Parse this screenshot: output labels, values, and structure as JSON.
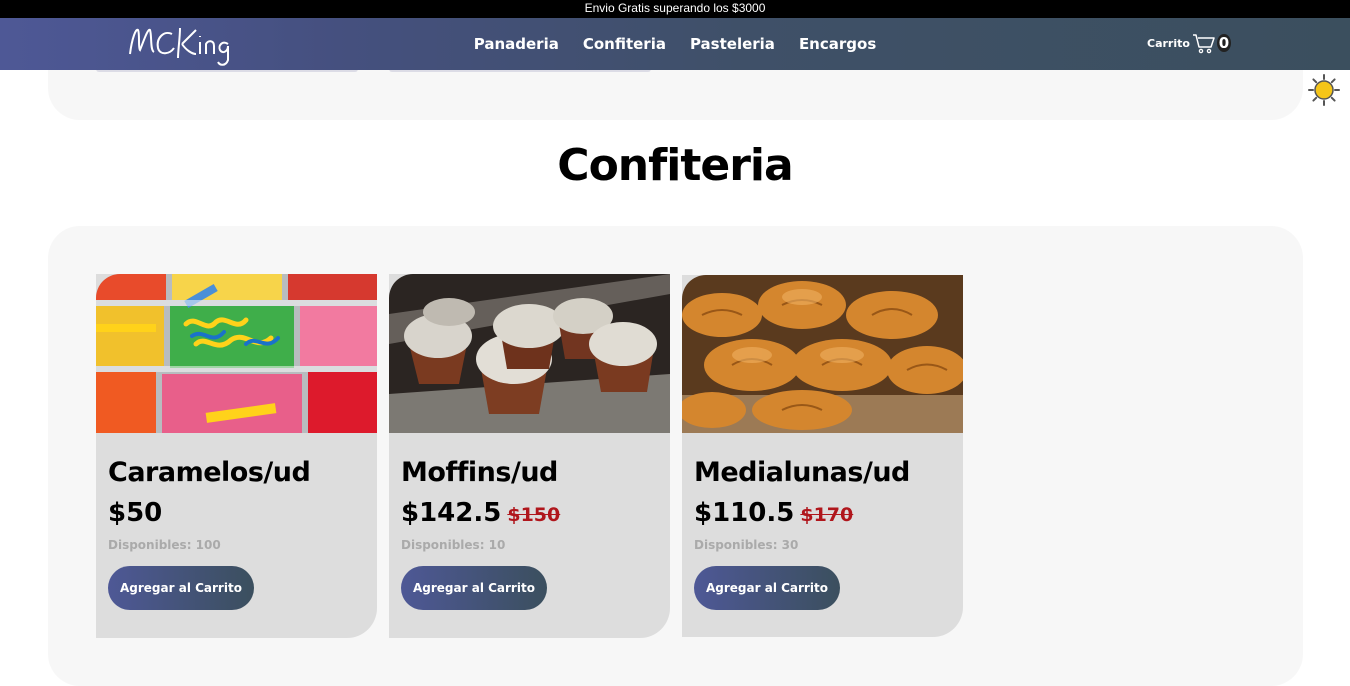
{
  "announcement": "Envio Gratis superando los $3000",
  "brand": {
    "logo_text": "MCKing"
  },
  "nav": {
    "links": [
      "Panaderia",
      "Confiteria",
      "Pasteleria",
      "Encargos"
    ]
  },
  "cart": {
    "label": "Carrito",
    "count": "0",
    "icon": "cart-icon"
  },
  "theme_toggle": {
    "icon": "sun-icon"
  },
  "section": {
    "title": "Confiteria"
  },
  "products": [
    {
      "name": "Caramelos/ud",
      "price": "$50",
      "old_price": "",
      "stock": "Disponibles: 100",
      "button": "Agregar al Carrito",
      "image": "candy-photo"
    },
    {
      "name": "Moffins/ud",
      "price": "$142.5",
      "old_price": "$150",
      "stock": "Disponibles: 10",
      "button": "Agregar al Carrito",
      "image": "muffins-photo"
    },
    {
      "name": "Medialunas/ud",
      "price": "$110.5",
      "old_price": "$170",
      "stock": "Disponibles: 30",
      "button": "Agregar al Carrito",
      "image": "croissants-photo"
    }
  ],
  "colors": {
    "nav_gradient_start": "#4e5896",
    "nav_gradient_end": "#3b4f5e",
    "old_price": "#b0161c",
    "card_bg": "#dddddd",
    "panel_bg": "#f7f7f7"
  }
}
